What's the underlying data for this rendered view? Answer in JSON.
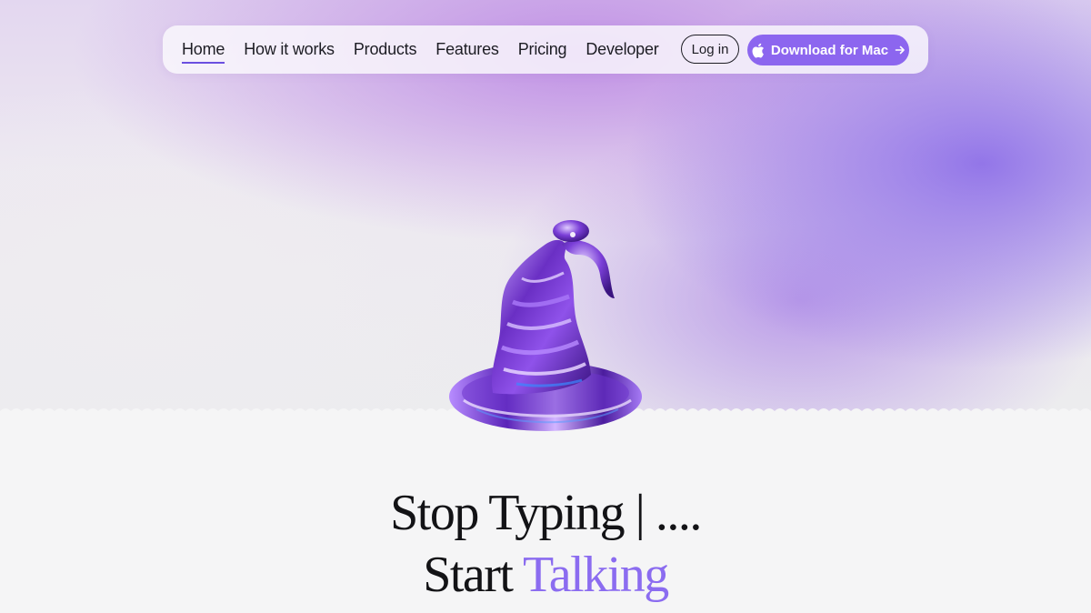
{
  "nav": {
    "links": [
      {
        "label": "Home",
        "active": true
      },
      {
        "label": "How it works",
        "active": false
      },
      {
        "label": "Products",
        "active": false
      },
      {
        "label": "Features",
        "active": false
      },
      {
        "label": "Pricing",
        "active": false
      },
      {
        "label": "Developer",
        "active": false
      }
    ],
    "login_label": "Log in",
    "download_label": "Download for Mac",
    "download_icon": "apple-icon",
    "download_arrow": "arrow-right-icon"
  },
  "hero": {
    "illustration": "wizard-hat-illustration",
    "headline_line1": "Stop Typing | ....",
    "headline_line2_plain": "Start ",
    "headline_line2_accent": "Talking"
  },
  "colors": {
    "accent": "#8c66ef",
    "accent_text": "#8b6cf0",
    "active_underline": "#6b4fe0",
    "text": "#131316"
  }
}
